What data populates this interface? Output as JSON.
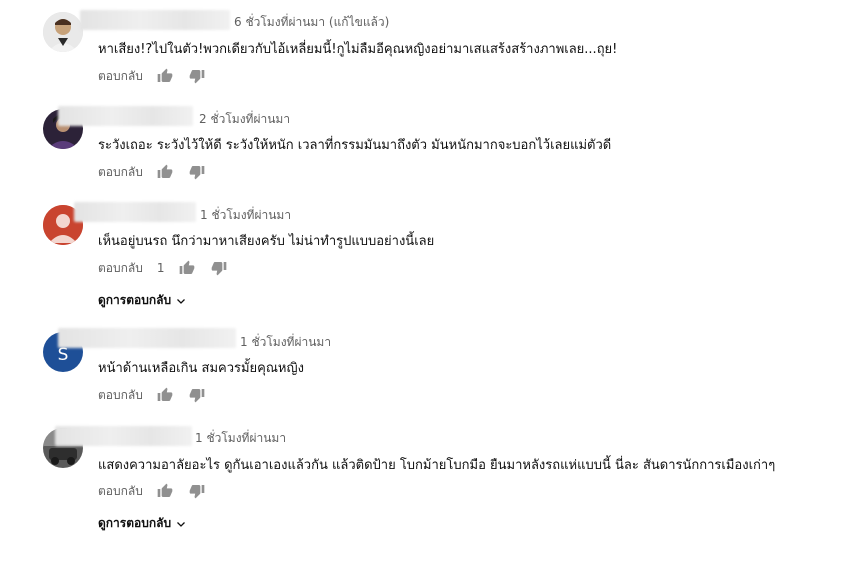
{
  "comments": [
    {
      "time": "6 ชั่วโมงที่ผ่านมา (แก้ไขแล้ว)",
      "text": "หาเสียง!?ไปในตัว!พวกเดียวกับไอ้เหลี่ยมนี้!กูไม่ลืมอีคุณหญิงอย่ามาเสแสร้งสร้างภาพเลย...ถุย!",
      "reply_label": "ตอบกลับ",
      "likes": "",
      "avatar_color": "#c9c9c9"
    },
    {
      "time": "2 ชั่วโมงที่ผ่านมา",
      "text": "ระวังเถอะ ระวังไว้ให้ดี ระวังให้หนัก เวลาที่กรรมมันมาถึงตัว มันหนักมากจะบอกไว้เลยแม่ตัวดี",
      "reply_label": "ตอบกลับ",
      "likes": "",
      "avatar_color": "#3b2a4a"
    },
    {
      "time": "1 ชั่วโมงที่ผ่านมา",
      "text": "เห็นอยู่บนรถ นึกว่ามาหาเสียงครับ  ไม่น่าทำรูปแบบอย่างนี้เลย",
      "reply_label": "ตอบกลับ",
      "likes": "1",
      "view_replies": "ดูการตอบกลับ",
      "avatar_color": "#c0392b"
    },
    {
      "time": "1 ชั่วโมงที่ผ่านมา",
      "text": "หน้าด้านเหลือเกิน สมควรมั้ยคุณหญิง",
      "reply_label": "ตอบกลับ",
      "likes": "",
      "avatar_letter": "S",
      "avatar_color": "#1e4f97"
    },
    {
      "time": "1 ชั่วโมงที่ผ่านมา",
      "text": "แสดงความอาลัยอะไร ดูกันเอาเองแล้วกัน แล้วติดป้าย โบกม้ายโบกมือ ยืนมาหลังรถแห่แบบนี้ นี่ละ สันดารนักการเมืองเก่าๆ",
      "reply_label": "ตอบกลับ",
      "likes": "",
      "view_replies": "ดูการตอบกลับ",
      "avatar_color": "#4a4a4a"
    }
  ]
}
